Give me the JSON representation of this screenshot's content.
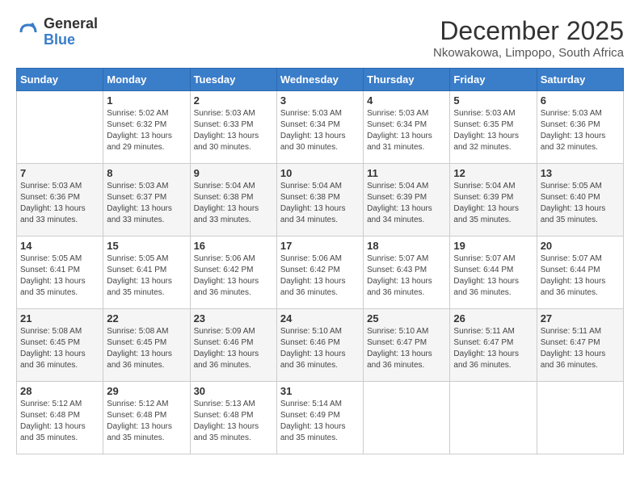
{
  "logo": {
    "general": "General",
    "blue": "Blue"
  },
  "header": {
    "month": "December 2025",
    "location": "Nkowakowa, Limpopo, South Africa"
  },
  "weekdays": [
    "Sunday",
    "Monday",
    "Tuesday",
    "Wednesday",
    "Thursday",
    "Friday",
    "Saturday"
  ],
  "weeks": [
    [
      {
        "day": "",
        "sunrise": "",
        "sunset": "",
        "daylight": ""
      },
      {
        "day": "1",
        "sunrise": "Sunrise: 5:02 AM",
        "sunset": "Sunset: 6:32 PM",
        "daylight": "Daylight: 13 hours and 29 minutes."
      },
      {
        "day": "2",
        "sunrise": "Sunrise: 5:03 AM",
        "sunset": "Sunset: 6:33 PM",
        "daylight": "Daylight: 13 hours and 30 minutes."
      },
      {
        "day": "3",
        "sunrise": "Sunrise: 5:03 AM",
        "sunset": "Sunset: 6:34 PM",
        "daylight": "Daylight: 13 hours and 30 minutes."
      },
      {
        "day": "4",
        "sunrise": "Sunrise: 5:03 AM",
        "sunset": "Sunset: 6:34 PM",
        "daylight": "Daylight: 13 hours and 31 minutes."
      },
      {
        "day": "5",
        "sunrise": "Sunrise: 5:03 AM",
        "sunset": "Sunset: 6:35 PM",
        "daylight": "Daylight: 13 hours and 32 minutes."
      },
      {
        "day": "6",
        "sunrise": "Sunrise: 5:03 AM",
        "sunset": "Sunset: 6:36 PM",
        "daylight": "Daylight: 13 hours and 32 minutes."
      }
    ],
    [
      {
        "day": "7",
        "sunrise": "Sunrise: 5:03 AM",
        "sunset": "Sunset: 6:36 PM",
        "daylight": "Daylight: 13 hours and 33 minutes."
      },
      {
        "day": "8",
        "sunrise": "Sunrise: 5:03 AM",
        "sunset": "Sunset: 6:37 PM",
        "daylight": "Daylight: 13 hours and 33 minutes."
      },
      {
        "day": "9",
        "sunrise": "Sunrise: 5:04 AM",
        "sunset": "Sunset: 6:38 PM",
        "daylight": "Daylight: 13 hours and 33 minutes."
      },
      {
        "day": "10",
        "sunrise": "Sunrise: 5:04 AM",
        "sunset": "Sunset: 6:38 PM",
        "daylight": "Daylight: 13 hours and 34 minutes."
      },
      {
        "day": "11",
        "sunrise": "Sunrise: 5:04 AM",
        "sunset": "Sunset: 6:39 PM",
        "daylight": "Daylight: 13 hours and 34 minutes."
      },
      {
        "day": "12",
        "sunrise": "Sunrise: 5:04 AM",
        "sunset": "Sunset: 6:39 PM",
        "daylight": "Daylight: 13 hours and 35 minutes."
      },
      {
        "day": "13",
        "sunrise": "Sunrise: 5:05 AM",
        "sunset": "Sunset: 6:40 PM",
        "daylight": "Daylight: 13 hours and 35 minutes."
      }
    ],
    [
      {
        "day": "14",
        "sunrise": "Sunrise: 5:05 AM",
        "sunset": "Sunset: 6:41 PM",
        "daylight": "Daylight: 13 hours and 35 minutes."
      },
      {
        "day": "15",
        "sunrise": "Sunrise: 5:05 AM",
        "sunset": "Sunset: 6:41 PM",
        "daylight": "Daylight: 13 hours and 35 minutes."
      },
      {
        "day": "16",
        "sunrise": "Sunrise: 5:06 AM",
        "sunset": "Sunset: 6:42 PM",
        "daylight": "Daylight: 13 hours and 36 minutes."
      },
      {
        "day": "17",
        "sunrise": "Sunrise: 5:06 AM",
        "sunset": "Sunset: 6:42 PM",
        "daylight": "Daylight: 13 hours and 36 minutes."
      },
      {
        "day": "18",
        "sunrise": "Sunrise: 5:07 AM",
        "sunset": "Sunset: 6:43 PM",
        "daylight": "Daylight: 13 hours and 36 minutes."
      },
      {
        "day": "19",
        "sunrise": "Sunrise: 5:07 AM",
        "sunset": "Sunset: 6:44 PM",
        "daylight": "Daylight: 13 hours and 36 minutes."
      },
      {
        "day": "20",
        "sunrise": "Sunrise: 5:07 AM",
        "sunset": "Sunset: 6:44 PM",
        "daylight": "Daylight: 13 hours and 36 minutes."
      }
    ],
    [
      {
        "day": "21",
        "sunrise": "Sunrise: 5:08 AM",
        "sunset": "Sunset: 6:45 PM",
        "daylight": "Daylight: 13 hours and 36 minutes."
      },
      {
        "day": "22",
        "sunrise": "Sunrise: 5:08 AM",
        "sunset": "Sunset: 6:45 PM",
        "daylight": "Daylight: 13 hours and 36 minutes."
      },
      {
        "day": "23",
        "sunrise": "Sunrise: 5:09 AM",
        "sunset": "Sunset: 6:46 PM",
        "daylight": "Daylight: 13 hours and 36 minutes."
      },
      {
        "day": "24",
        "sunrise": "Sunrise: 5:10 AM",
        "sunset": "Sunset: 6:46 PM",
        "daylight": "Daylight: 13 hours and 36 minutes."
      },
      {
        "day": "25",
        "sunrise": "Sunrise: 5:10 AM",
        "sunset": "Sunset: 6:47 PM",
        "daylight": "Daylight: 13 hours and 36 minutes."
      },
      {
        "day": "26",
        "sunrise": "Sunrise: 5:11 AM",
        "sunset": "Sunset: 6:47 PM",
        "daylight": "Daylight: 13 hours and 36 minutes."
      },
      {
        "day": "27",
        "sunrise": "Sunrise: 5:11 AM",
        "sunset": "Sunset: 6:47 PM",
        "daylight": "Daylight: 13 hours and 36 minutes."
      }
    ],
    [
      {
        "day": "28",
        "sunrise": "Sunrise: 5:12 AM",
        "sunset": "Sunset: 6:48 PM",
        "daylight": "Daylight: 13 hours and 35 minutes."
      },
      {
        "day": "29",
        "sunrise": "Sunrise: 5:12 AM",
        "sunset": "Sunset: 6:48 PM",
        "daylight": "Daylight: 13 hours and 35 minutes."
      },
      {
        "day": "30",
        "sunrise": "Sunrise: 5:13 AM",
        "sunset": "Sunset: 6:48 PM",
        "daylight": "Daylight: 13 hours and 35 minutes."
      },
      {
        "day": "31",
        "sunrise": "Sunrise: 5:14 AM",
        "sunset": "Sunset: 6:49 PM",
        "daylight": "Daylight: 13 hours and 35 minutes."
      },
      {
        "day": "",
        "sunrise": "",
        "sunset": "",
        "daylight": ""
      },
      {
        "day": "",
        "sunrise": "",
        "sunset": "",
        "daylight": ""
      },
      {
        "day": "",
        "sunrise": "",
        "sunset": "",
        "daylight": ""
      }
    ]
  ]
}
